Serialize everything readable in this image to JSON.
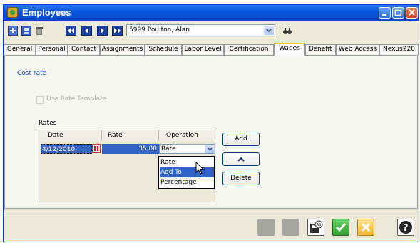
{
  "window": {
    "title": "Employees"
  },
  "toolbar": {
    "employee_select": {
      "value": "5999 Poulton, Alan"
    }
  },
  "tabs": [
    "General",
    "Personal",
    "Contact",
    "Assignments",
    "Schedule",
    "Labor Level",
    "Certification",
    "Wages",
    "Benefit",
    "Web Access",
    "Nexus220"
  ],
  "active_tab": "Wages",
  "wages": {
    "cost_rate_link": "Cost rate",
    "use_rate_template": {
      "label": "Use Rate Template",
      "checked": false,
      "enabled": false
    },
    "rates_label": "Rates",
    "columns": [
      "Date",
      "Rate",
      "Operation"
    ],
    "rows": [
      {
        "date": "4/12/2010",
        "rate": "35.00",
        "operation": "Rate"
      }
    ],
    "operation_options": [
      "Rate",
      "Add To",
      "Percentage"
    ],
    "highlighted_option": "Add To",
    "buttons": {
      "add": "Add",
      "delete": "Delete"
    }
  },
  "colors": {
    "titlebar": "#0a56e0",
    "selection": "#3163c5",
    "link": "#1a4bc3"
  },
  "icons": [
    "add-record-icon",
    "save-icon",
    "delete-icon",
    "first-record-icon",
    "previous-record-icon",
    "next-record-icon",
    "last-record-icon",
    "binoculars-icon",
    "move-up-icon",
    "save-as-icon",
    "ok-icon",
    "cancel-icon",
    "help-icon"
  ]
}
